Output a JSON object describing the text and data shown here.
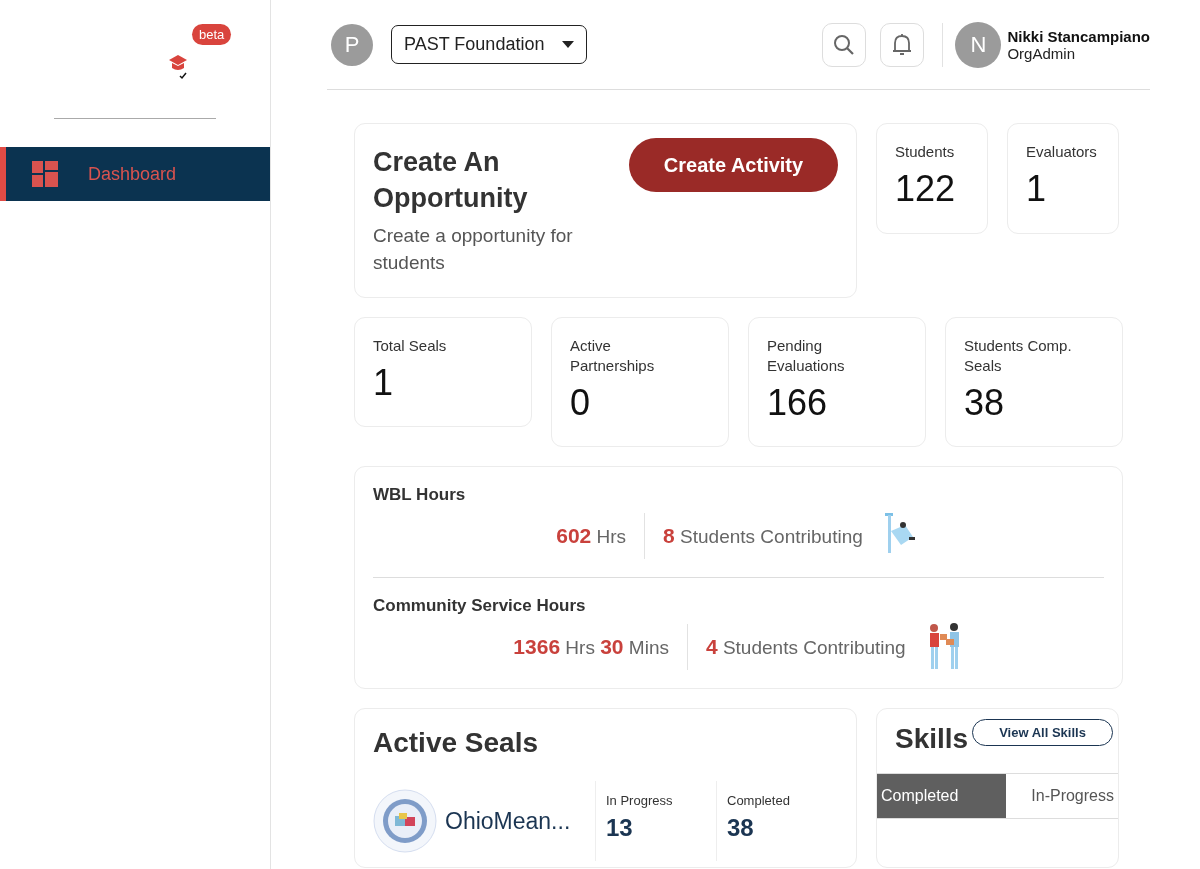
{
  "sidebar": {
    "badge": "beta",
    "items": [
      {
        "label": "Dashboard",
        "selected": true
      }
    ]
  },
  "header": {
    "org_initial": "P",
    "org_select": "PAST Foundation",
    "user": {
      "initial": "N",
      "name": "Nikki Stancampiano",
      "role": "OrgAdmin"
    }
  },
  "create_card": {
    "title": "Create An Opportunity",
    "subtitle": "Create a opportunity for students",
    "button": "Create Activity"
  },
  "stats_top": [
    {
      "label": "Students",
      "value": "122"
    },
    {
      "label": "Evaluators",
      "value": "1"
    }
  ],
  "stats": [
    {
      "label": "Total Seals",
      "value": "1"
    },
    {
      "label": "Active Partnerships",
      "value": "0"
    },
    {
      "label": "Pending Evaluations",
      "value": "166"
    },
    {
      "label": "Students Comp. Seals",
      "value": "38"
    }
  ],
  "hours": [
    {
      "title": "WBL Hours",
      "parts": [
        {
          "value": "602",
          "unit": "Hrs"
        }
      ],
      "students": "8",
      "students_label": "Students Contributing",
      "kind": "work"
    },
    {
      "title": "Community Service Hours",
      "parts": [
        {
          "value": "1366",
          "unit": "Hrs"
        },
        {
          "value": "30",
          "unit": "Mins"
        }
      ],
      "students": "4",
      "students_label": "Students Contributing",
      "kind": "service"
    }
  ],
  "active_seals": {
    "title": "Active Seals",
    "seals": [
      {
        "name": "OhioMean...",
        "in_progress_label": "In Progress",
        "in_progress": "13",
        "completed_label": "Completed",
        "completed": "38"
      }
    ]
  },
  "skills": {
    "title": "Skills",
    "button": "View All Skills",
    "tabs": [
      {
        "label": "Completed",
        "selected": true
      },
      {
        "label": "In-Progress",
        "selected": false
      }
    ]
  }
}
